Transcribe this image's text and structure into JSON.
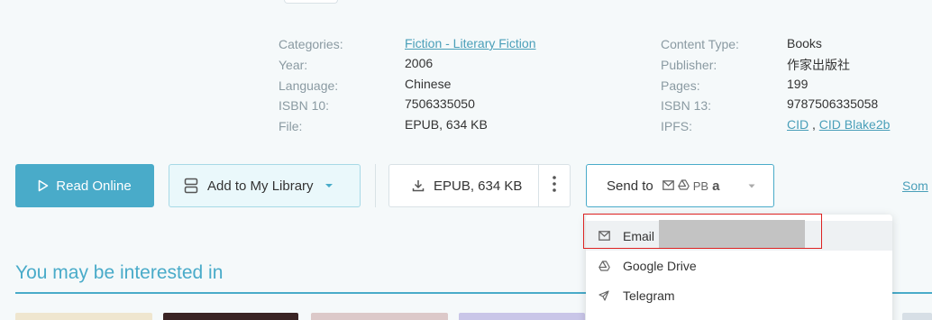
{
  "details_left": [
    {
      "label": "Categories:",
      "value": "Fiction - Literary Fiction",
      "link": true
    },
    {
      "label": "Year:",
      "value": "2006"
    },
    {
      "label": "Language:",
      "value": "Chinese"
    },
    {
      "label": "ISBN 10:",
      "value": "7506335050"
    },
    {
      "label": "File:",
      "value": "EPUB, 634 KB"
    }
  ],
  "details_right": [
    {
      "label": "Content Type:",
      "value": "Books"
    },
    {
      "label": "Publisher:",
      "value": "作家出版社"
    },
    {
      "label": "Pages:",
      "value": "199"
    },
    {
      "label": "ISBN 13:",
      "value": "9787506335058"
    },
    {
      "label": "IPFS:",
      "value_a": "CID",
      "sep": ",",
      "value_b": "CID Blake2b"
    }
  ],
  "actions": {
    "read_online": "Read Online",
    "add_library": "Add to My Library",
    "download": "EPUB, 634 KB",
    "send_to": "Send to",
    "send_services": "PB",
    "some_link": "Som"
  },
  "section": {
    "title": "You may be interested in"
  },
  "dropdown": {
    "items": [
      {
        "label": "Email",
        "icon": "mail-icon"
      },
      {
        "label": "Google Drive",
        "icon": "google-drive-icon"
      },
      {
        "label": "Telegram",
        "icon": "telegram-icon"
      }
    ]
  },
  "colors": {
    "accent": "#49abc9",
    "background": "#f5f9fa",
    "highlight": "#dd2222"
  }
}
